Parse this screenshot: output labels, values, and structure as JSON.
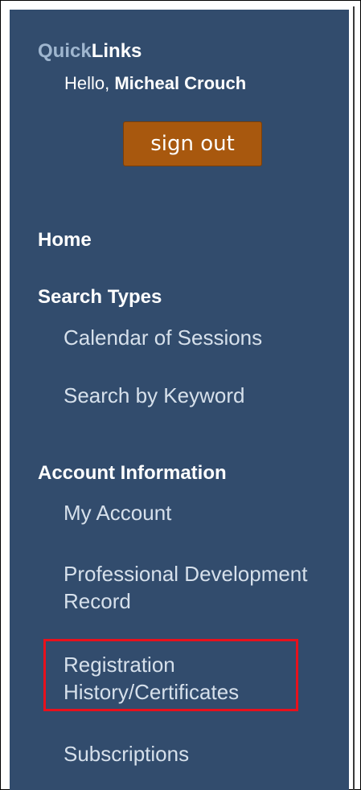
{
  "quicklinks": {
    "title_part1": "Quick",
    "title_part2": "Links",
    "greeting_prefix": "Hello, ",
    "user_name": "Micheal Crouch",
    "signout_label": "sign out"
  },
  "nav": {
    "home": "Home",
    "search_types": {
      "heading": "Search Types",
      "items": [
        "Calendar of Sessions",
        "Search by Keyword"
      ]
    },
    "account_information": {
      "heading": "Account Information",
      "items": [
        "My Account",
        "Professional Development Record",
        "Registration History/Certificates",
        "Subscriptions"
      ]
    }
  },
  "colors": {
    "panel_background": "#324c6d",
    "signout_button": "#a8580e",
    "highlight_border": "#e8111c"
  }
}
